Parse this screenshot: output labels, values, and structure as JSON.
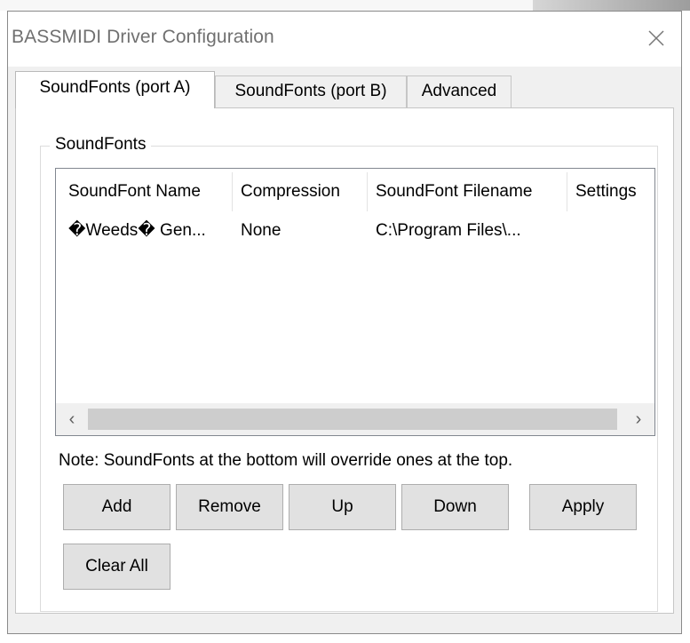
{
  "window": {
    "title": "BASSMIDI Driver Configuration",
    "close_icon": "close-icon"
  },
  "tabs": [
    {
      "label": "SoundFonts (port A)",
      "active": true
    },
    {
      "label": "SoundFonts (port B)",
      "active": false
    },
    {
      "label": "Advanced",
      "active": false
    }
  ],
  "group": {
    "label": "SoundFonts"
  },
  "list": {
    "columns": [
      "SoundFont Name",
      "Compression",
      "SoundFont Filename",
      "Settings"
    ],
    "rows": [
      {
        "name": "�Weeds� Gen...",
        "compression": "None",
        "filename": "C:\\Program Files\\...",
        "settings": ""
      }
    ],
    "scroll_left_icon": "chevron-left-icon",
    "scroll_right_icon": "chevron-right-icon"
  },
  "note": "Note: SoundFonts at the bottom will override ones at the top.",
  "buttons": {
    "add": "Add",
    "remove": "Remove",
    "up": "Up",
    "down": "Down",
    "apply": "Apply",
    "clear_all": "Clear All"
  }
}
